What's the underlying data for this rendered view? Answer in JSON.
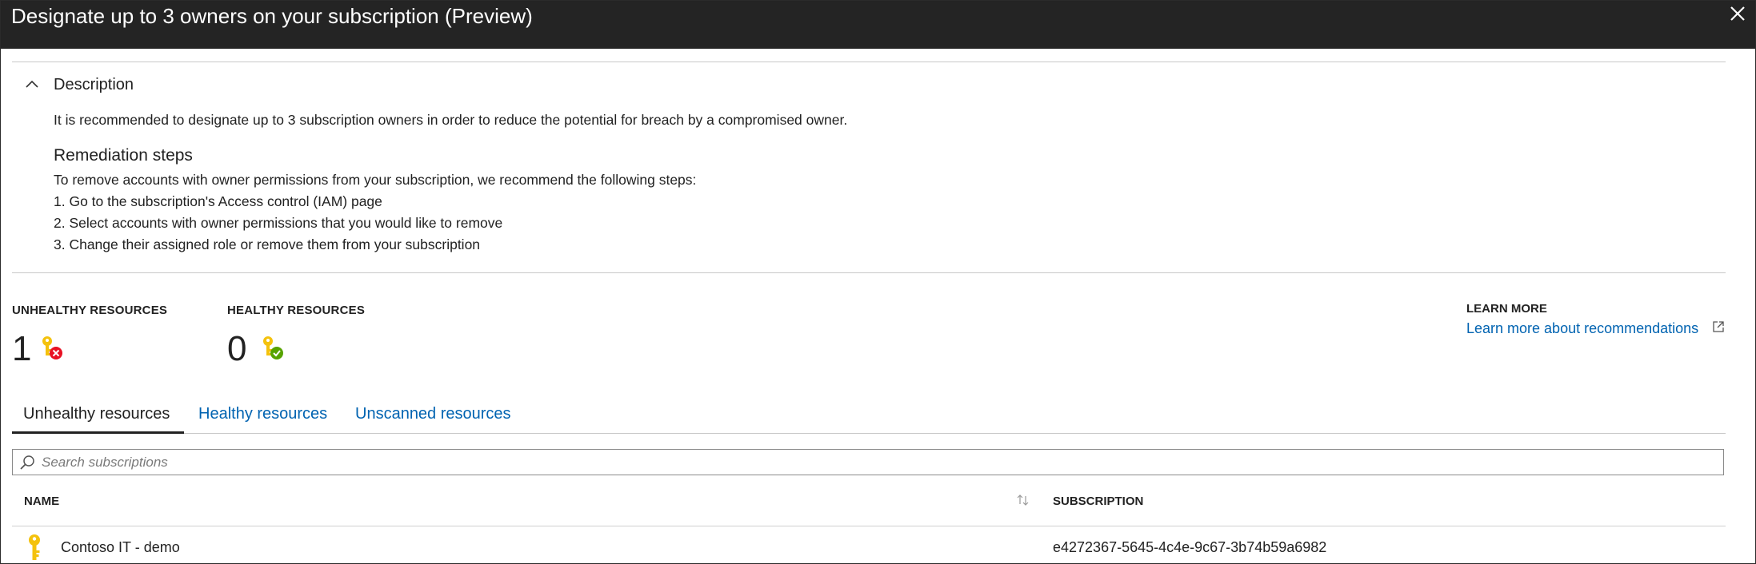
{
  "header": {
    "title": "Designate up to 3 owners on your subscription (Preview)",
    "close_icon": "close-icon"
  },
  "description": {
    "toggle_label": "Description",
    "toggle_icon": "chevron-up-icon",
    "text": "It is recommended to designate up to 3 subscription owners in order to reduce the potential for breach by a compromised owner."
  },
  "remediation": {
    "heading": "Remediation steps",
    "intro": "To remove accounts with owner permissions from your subscription, we recommend the following steps:",
    "steps": [
      "1. Go to the subscription's Access control (IAM) page",
      "2. Select accounts with owner permissions that you would like to remove",
      "3. Change their assigned role or remove them from your subscription"
    ]
  },
  "stats": {
    "unhealthy": {
      "label": "UNHEALTHY RESOURCES",
      "count": "1",
      "icon": "key-unhealthy-icon",
      "status_color": "#e81123"
    },
    "healthy": {
      "label": "HEALTHY RESOURCES",
      "count": "0",
      "icon": "key-healthy-icon",
      "status_color": "#57a300"
    }
  },
  "learn_more": {
    "label": "LEARN MORE",
    "link_text": "Learn more about recommendations",
    "icon": "external-link-icon"
  },
  "tabs": [
    {
      "label": "Unhealthy resources",
      "active": true
    },
    {
      "label": "Healthy resources",
      "active": false
    },
    {
      "label": "Unscanned resources",
      "active": false
    }
  ],
  "search": {
    "placeholder": "Search subscriptions",
    "value": "",
    "icon": "search-icon"
  },
  "table": {
    "columns": [
      "NAME",
      "SUBSCRIPTION"
    ],
    "sort_icon": "sort-icon",
    "rows": [
      {
        "icon": "key-icon",
        "name": "Contoso IT - demo",
        "subscription": "e4272367-5645-4c4e-9c67-3b74b59a6982"
      }
    ]
  },
  "colors": {
    "titlebar": "#242424",
    "link": "#0063b1",
    "key": "#f4c20d"
  }
}
